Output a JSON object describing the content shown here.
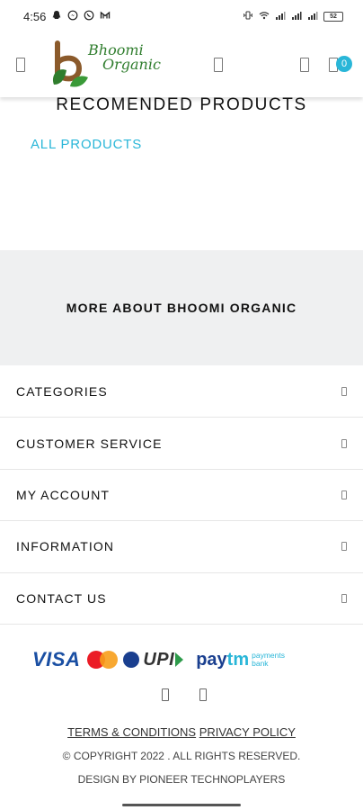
{
  "status_bar": {
    "time": "4:56",
    "notification_icons": [
      "snapchat-ghost-icon",
      "messenger-icon",
      "whatsapp-icon",
      "gmail-icon"
    ],
    "battery": "52"
  },
  "header": {
    "logo_line1": "Bhoomi",
    "logo_line2": "Organic",
    "cart_count": "0"
  },
  "main": {
    "recommended_title": "RECOMENDED PRODUCTS",
    "all_products_link": "ALL PRODUCTS",
    "more_about_title": "MORE ABOUT BHOOMI ORGANIC",
    "accordion": [
      {
        "label": "CATEGORIES"
      },
      {
        "label": "CUSTOMER SERVICE"
      },
      {
        "label": "MY ACCOUNT"
      },
      {
        "label": "INFORMATION"
      },
      {
        "label": "CONTACT US"
      }
    ]
  },
  "payments": {
    "visa": "VISA",
    "upi": "UPI",
    "paytm_pay": "pay",
    "paytm_tm": "tm",
    "paytm_sub": "payments bank"
  },
  "footer": {
    "terms": "TERMS & CONDITIONS",
    "privacy": "PRIVACY POLICY",
    "copyright": "© COPYRIGHT 2022 . ALL RIGHTS RESERVED.",
    "credits": "DESIGN BY PIONEER TECHNOPLAYERS"
  },
  "colors": {
    "accent": "#29b6d8",
    "logo_green": "#2f7d2d",
    "logo_brown": "#8b5a2b",
    "section_bg": "#eff0f1"
  }
}
